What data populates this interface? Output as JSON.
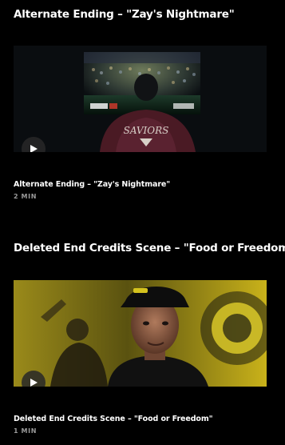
{
  "clips": [
    {
      "section_title": "Alternate Ending – \"Zay's Nightmare\"",
      "title": "Alternate Ending – \"Zay's Nightmare\"",
      "duration": "2 MIN",
      "jersey_text": "SAVIORS",
      "play_icon": "play-icon"
    },
    {
      "section_title": "Deleted End Credits Scene – \"Food or Freedom\"",
      "title": "Deleted End Credits Scene – \"Food or Freedom\"",
      "duration": "1 MIN",
      "play_icon": "play-icon"
    }
  ],
  "colors": {
    "background": "#000000",
    "title_text": "#ffffff",
    "meta_text": "#9a9a9a",
    "play_button_bg": "#282828"
  }
}
